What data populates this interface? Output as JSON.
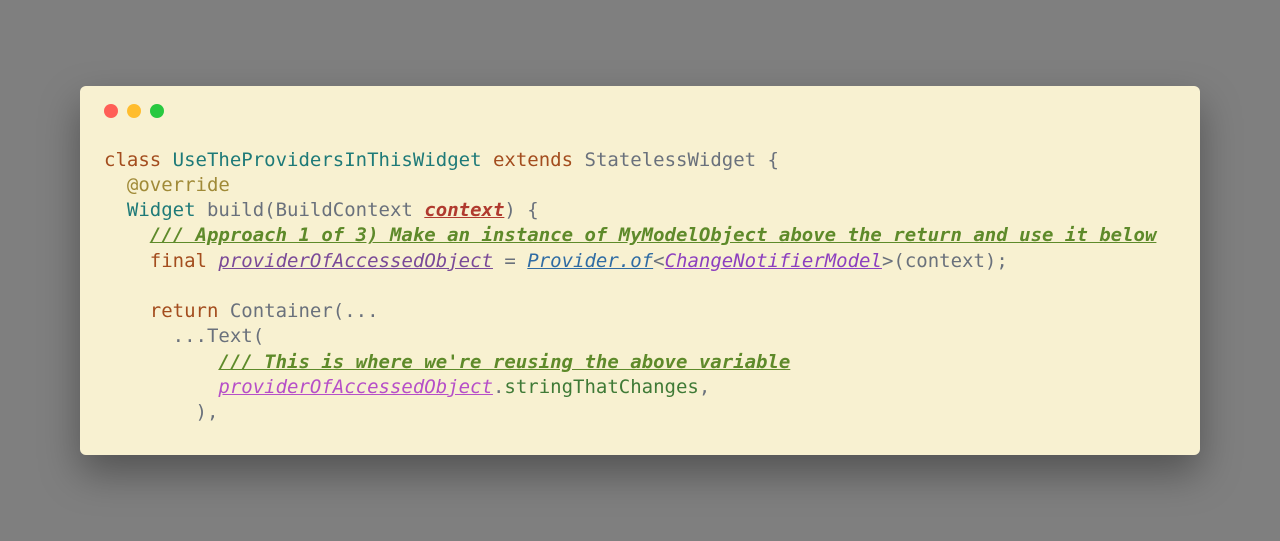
{
  "code": {
    "l1_class": "class",
    "l1_name": "UseTheProvidersInThisWidget",
    "l1_extends": "extends",
    "l1_super": "StatelessWidget",
    "l1_open": " {",
    "l2_indent": "  ",
    "l2_annot": "@override",
    "l3_indent": "  ",
    "l3_sig1": "Widget",
    "l3_sig2": " build(BuildContext ",
    "l3_param": "context",
    "l3_sig3": ") {",
    "l4_indent": "    ",
    "l4_comment": "/// Approach 1 of 3) Make an instance of MyModelObject above the return and use it below",
    "l5_indent": "    ",
    "l5_final": "final",
    "l5_var": "providerOfAccessedObject",
    "l5_eq": " = ",
    "l5_call": "Provider.of",
    "l5_lt": "<",
    "l5_gen": "ChangeNotifierModel",
    "l5_gt": ">",
    "l5_tail": "(context);",
    "l7_indent": "    ",
    "l7_return": "return",
    "l7_rest": " Container(...",
    "l8_indent": "      ",
    "l8_text": "...Text(",
    "l9_indent": "          ",
    "l9_comment": "/// This is where we're reusing the above variable",
    "l10_indent": "          ",
    "l10_var": "providerOfAccessedObject",
    "l10_dot": ".",
    "l10_member": "stringThatChanges",
    "l10_tail": ",",
    "l11_indent": "        ",
    "l11_close": "),"
  }
}
